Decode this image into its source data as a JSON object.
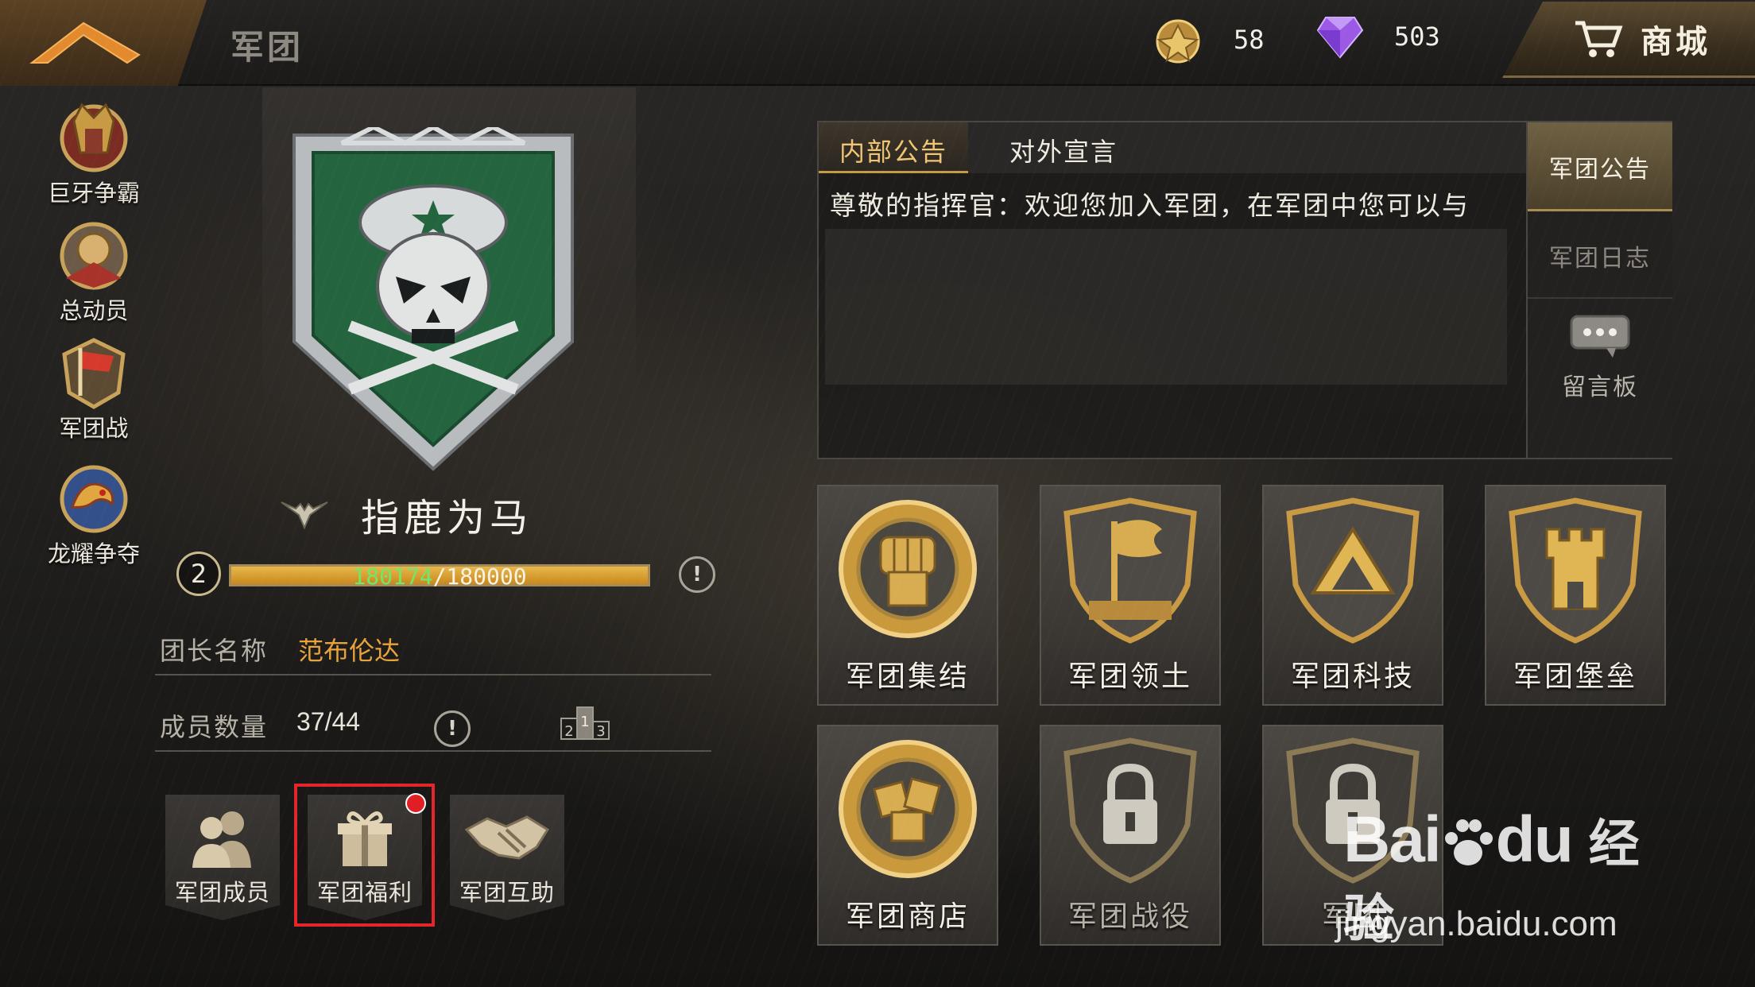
{
  "topbar": {
    "title": "军团",
    "currencies": [
      {
        "icon": "gold-medal-icon",
        "value": "58"
      },
      {
        "icon": "purple-diamond-icon",
        "value": "503"
      }
    ],
    "shop_label": "商城"
  },
  "sidebar": {
    "items": [
      {
        "label": "巨牙争霸"
      },
      {
        "label": "总动员"
      },
      {
        "label": "军团战"
      },
      {
        "label": "龙耀争夺"
      }
    ]
  },
  "guild": {
    "name": "指鹿为马",
    "level": "2",
    "xp_current": "180174",
    "xp_max": "180000",
    "xp_fill": 1.0,
    "leader_label": "团长名称",
    "leader_value": "范布伦达",
    "members_label": "成员数量",
    "members_value": "37/44"
  },
  "bottom_buttons": [
    {
      "label": "军团成员"
    },
    {
      "label": "军团福利"
    },
    {
      "label": "军团互助"
    }
  ],
  "notice": {
    "tabs": [
      "内部公告",
      "对外宣言"
    ],
    "text": "尊敬的指挥官：欢迎您加入军团，在军团中您可以与",
    "side_tabs": [
      "军团公告",
      "军团日志"
    ],
    "message_board": "留言板"
  },
  "features": [
    {
      "label": "军团集结"
    },
    {
      "label": "军团领土"
    },
    {
      "label": "军团科技"
    },
    {
      "label": "军团堡垒"
    },
    {
      "label": "军团商店"
    },
    {
      "label": "军团战役"
    },
    {
      "label": "军团"
    }
  ],
  "watermark": {
    "brand_a": "Bai",
    "brand_b": "du",
    "brand_c": "经验",
    "url": "jingyan.baidu.com"
  },
  "colors": {
    "accent_gold": "#e7a33c",
    "xp_green": "#6fe86a",
    "highlight_red": "#e3262a"
  }
}
